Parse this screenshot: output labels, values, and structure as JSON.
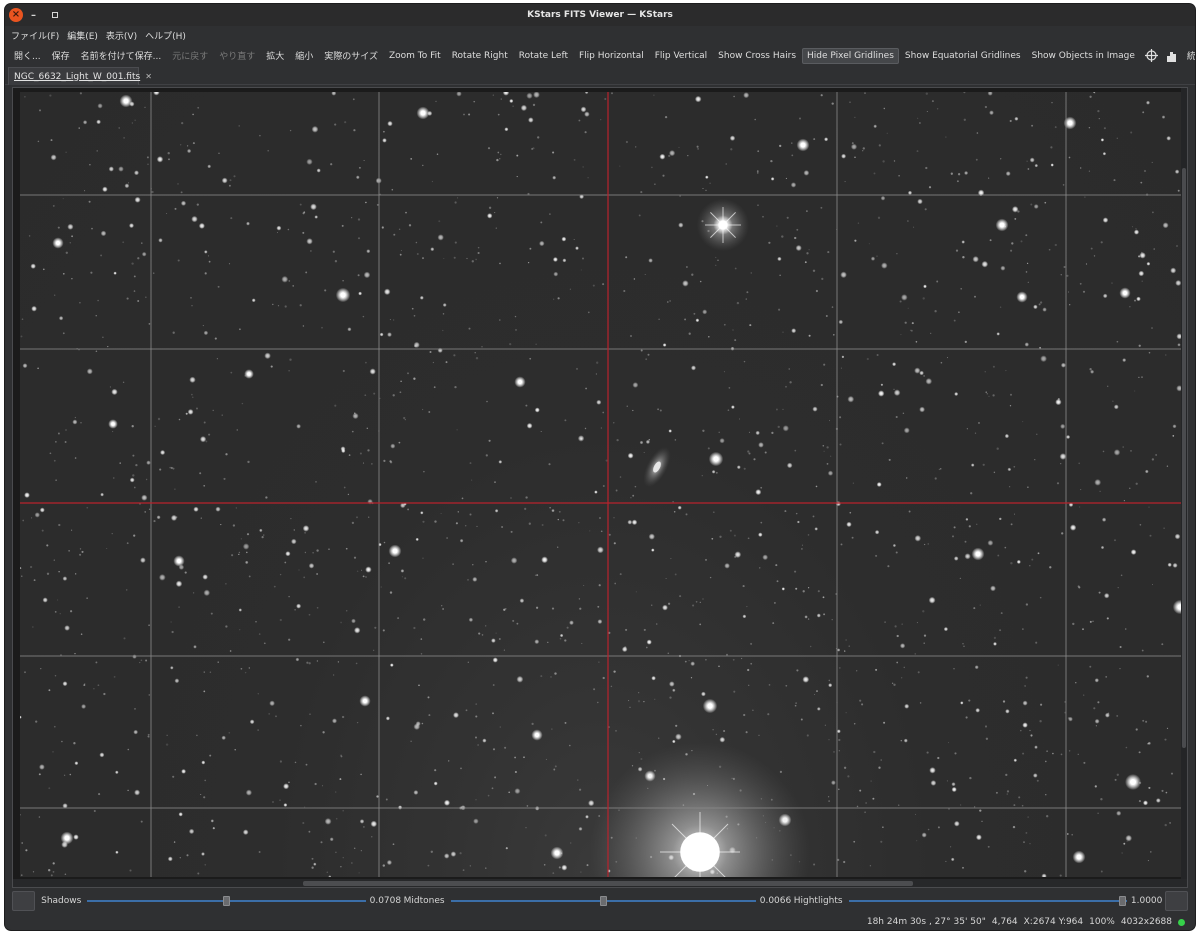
{
  "window": {
    "title": "KStars FITS Viewer — KStars"
  },
  "menu": [
    "ファイル(F)",
    "編集(E)",
    "表示(V)",
    "ヘルプ(H)"
  ],
  "toolbar": [
    {
      "label": "開く...",
      "name": "open-button"
    },
    {
      "label": "保存",
      "name": "save-button"
    },
    {
      "label": "名前を付けて保存...",
      "name": "save-as-button"
    },
    {
      "label": "元に戻す",
      "name": "undo-button",
      "disabled": true
    },
    {
      "label": "やり直す",
      "name": "redo-button",
      "disabled": true
    },
    {
      "label": "拡大",
      "name": "zoom-in-button"
    },
    {
      "label": "縮小",
      "name": "zoom-out-button"
    },
    {
      "label": "実際のサイズ",
      "name": "actual-size-button"
    },
    {
      "label": "Zoom To Fit",
      "name": "zoom-to-fit-button"
    },
    {
      "label": "Rotate Right",
      "name": "rotate-right-button"
    },
    {
      "label": "Rotate Left",
      "name": "rotate-left-button"
    },
    {
      "label": "Flip Horizontal",
      "name": "flip-horizontal-button"
    },
    {
      "label": "Flip Vertical",
      "name": "flip-vertical-button"
    },
    {
      "label": "Show Cross Hairs",
      "name": "show-cross-hairs-button"
    },
    {
      "label": "Hide Pixel Gridlines",
      "name": "hide-pixel-gridlines-button",
      "checked": true
    },
    {
      "label": "Show Equatorial Gridlines",
      "name": "show-equatorial-gridlines-button"
    },
    {
      "label": "Show Objects in Image",
      "name": "show-objects-button"
    }
  ],
  "toolbar_icons": [
    {
      "name": "crosshair-target-icon"
    },
    {
      "name": "histogram-icon"
    }
  ],
  "toolbar_stats_label": "統計",
  "tab": {
    "label": "NGC_6632_Light_W_001.fits",
    "close": "✕"
  },
  "stretch": {
    "shadows": {
      "label": "Shadows",
      "value": "0.0708",
      "level": 0.0708
    },
    "midtones": {
      "label": "Midtones",
      "value": "0.0066",
      "level": 0.5
    },
    "highlights": {
      "label": "Hightlights",
      "value": "1.0000",
      "level": 1.0
    }
  },
  "status": {
    "ra_dec": "18h 24m 30s ,  27° 35' 50\"",
    "value": "4,764",
    "xy": "X:2674 Y:964",
    "zoom": "100%",
    "size": "4032x2688"
  },
  "colors": {
    "accent_blue": "#3b6ea8",
    "crosshair_red": "#b8232d",
    "status_green": "#36d14a",
    "close_orange": "#e95420"
  }
}
